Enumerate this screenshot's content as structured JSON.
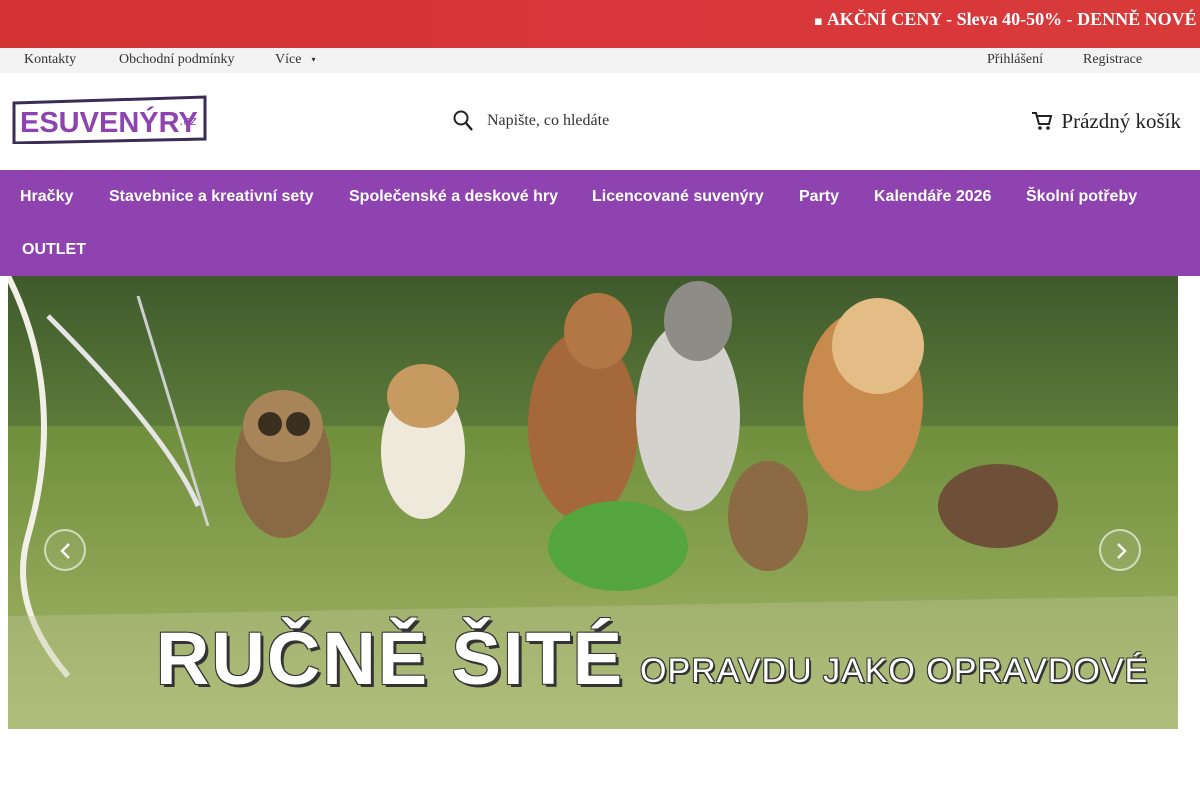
{
  "promo": {
    "icon": "tag-icon",
    "text": "AKČNÍ CENY - Sleva 40-50% - DENNĚ NOVÉ",
    "background": "#d33333"
  },
  "top_links": {
    "left": [
      {
        "label": "Kontakty"
      },
      {
        "label": "Obchodní podmínky"
      },
      {
        "label": "Více"
      }
    ],
    "right": [
      {
        "label": "Přihlášení"
      },
      {
        "label": "Registrace"
      }
    ]
  },
  "header": {
    "logo": {
      "main": "ESUVENÝRY",
      "suffix": ".cz",
      "border_color": "#3b2c55",
      "accent": "#8f43b0"
    },
    "search": {
      "placeholder": "Napište, co hledáte",
      "icon": "search-icon"
    },
    "cart": {
      "label": "Prázdný košík",
      "icon": "cart-icon"
    }
  },
  "nav": {
    "background": "#8f43b0",
    "items": [
      {
        "label": "Hračky"
      },
      {
        "label": "Stavebnice a kreativní sety"
      },
      {
        "label": "Společenské a deskové hry"
      },
      {
        "label": "Licencované suvenýry"
      },
      {
        "label": "Party"
      },
      {
        "label": "Kalendáře 2026"
      },
      {
        "label": "Školní potřeby"
      },
      {
        "label": "OUTLET"
      }
    ]
  },
  "hero": {
    "headline": "RUČNĚ ŠITÉ",
    "subline": "OPRAVDU JAKO OPRAVDOVÉ",
    "prev_icon": "chevron-left-icon",
    "next_icon": "chevron-right-icon"
  }
}
